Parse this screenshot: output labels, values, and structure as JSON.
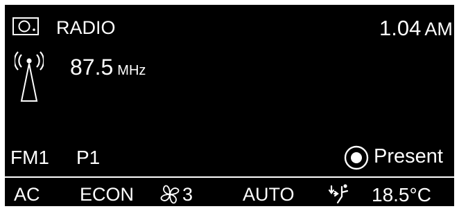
{
  "header": {
    "source_icon": "radio-icon",
    "source_label": "RADIO",
    "clock_time": "1.04",
    "clock_meridiem": "AM"
  },
  "tuner": {
    "antenna_icon": "antenna-signal-icon",
    "frequency_value": "87.5",
    "frequency_unit": "MHz"
  },
  "status": {
    "band": "FM1",
    "preset": "P1",
    "present_icon": "radio-button-selected-icon",
    "present_label": "Present"
  },
  "climate": {
    "ac_label": "AC",
    "econ_label": "ECON",
    "fan_icon": "fan-icon",
    "fan_speed": "3",
    "auto_label": "AUTO",
    "airflow_icon": "airflow-seat-icon",
    "temperature": "18.5°C"
  },
  "colors": {
    "screen_background": "#000000",
    "foreground": "#ffffff",
    "frame": "#ffffff"
  }
}
